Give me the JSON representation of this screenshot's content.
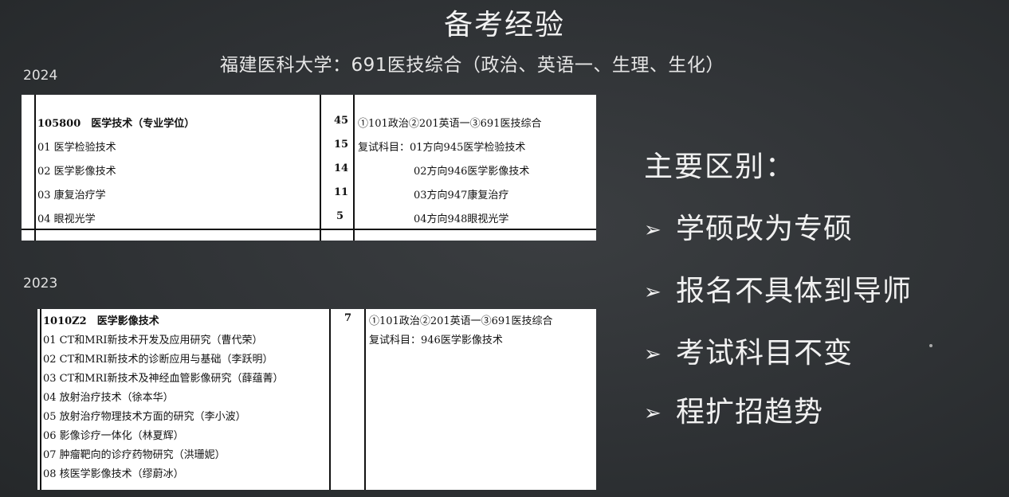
{
  "title": "备考经验",
  "subtitle": "福建医科大学：691医技综合（政治、英语一、生理、生化）",
  "year_2024": "2024",
  "year_2023": "2023",
  "table_2024": {
    "rows": [
      {
        "name": "105800　医学技术（专业学位）",
        "count": "45",
        "note": "①101政治②201英语一③691医技综合"
      },
      {
        "name": "01 医学检验技术",
        "count": "15",
        "note": "复试科目：01方向945医学检验技术"
      },
      {
        "name": "02 医学影像技术",
        "count": "14",
        "note": "02方向946医学影像技术"
      },
      {
        "name": "03 康复治疗学",
        "count": "11",
        "note": "03方向947康复治疗"
      },
      {
        "name": "04 眼视光学",
        "count": "5",
        "note": "04方向948眼视光学"
      }
    ]
  },
  "table_2023": {
    "header": {
      "name": "1010Z2　医学影像技术",
      "count": "7",
      "note1": "①101政治②201英语一③691医技综合",
      "note2": "复试科目：946医学影像技术"
    },
    "rows": [
      "01 CT和MRI新技术开发及应用研究（曹代荣）",
      "02 CT和MRI新技术的诊断应用与基础（李跃明）",
      "03 CT和MRI新技术及神经血管影像研究（薛蕴菁）",
      "04 放射治疗技术（徐本华）",
      "05 放射治疗物理技术方面的研究（李小波）",
      "06 影像诊疗一体化（林夏辉）",
      "07 肿瘤靶向的诊疗药物研究（洪珊妮）",
      "08 核医学影像技术（缪蔚冰）"
    ]
  },
  "differences": {
    "heading": "主要区别：",
    "bullet": "➢",
    "items": [
      "学硕改为专硕",
      "报名不具体到导师",
      "考试科目不变",
      "程扩招趋势"
    ]
  }
}
